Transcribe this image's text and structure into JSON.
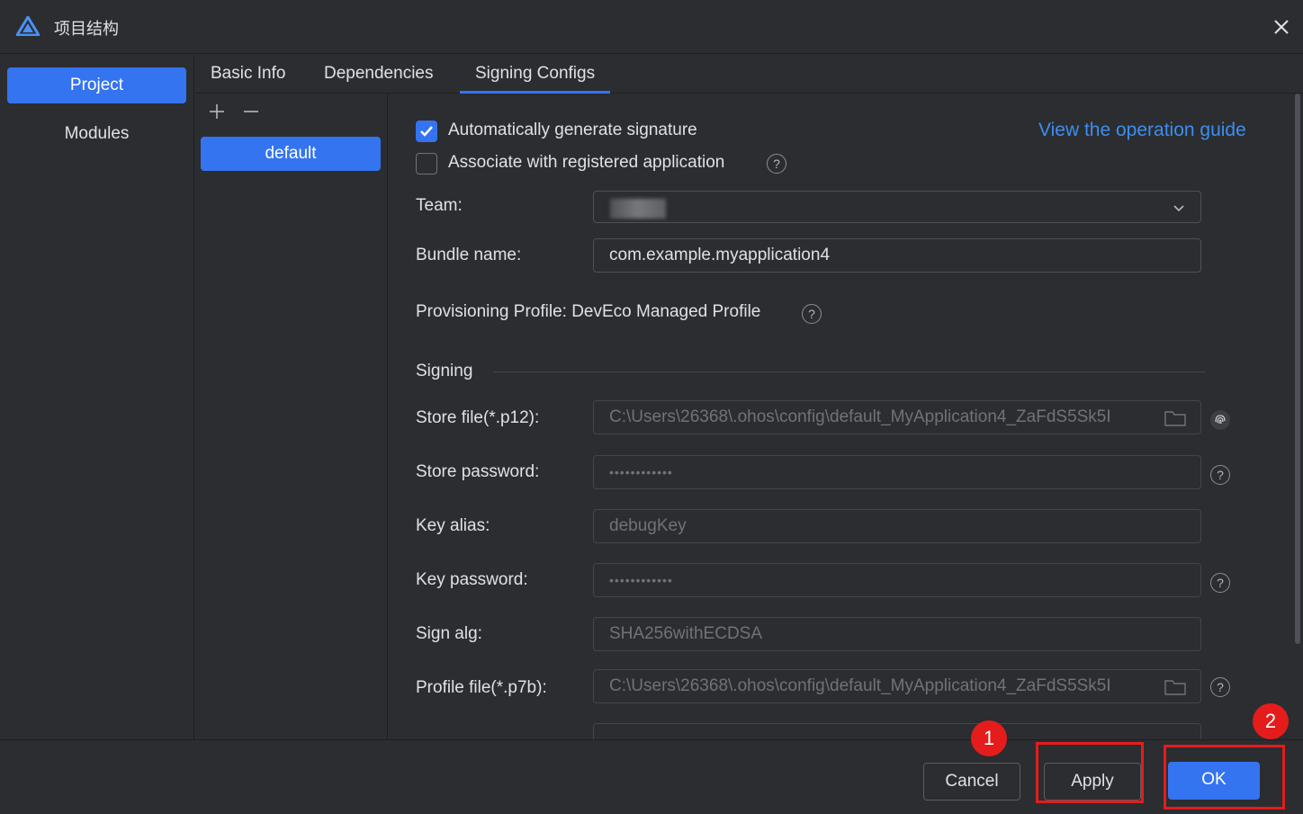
{
  "window": {
    "title": "项目结构"
  },
  "left_nav": {
    "items": [
      {
        "label": "Project",
        "selected": true
      },
      {
        "label": "Modules",
        "selected": false
      }
    ]
  },
  "tabs": [
    {
      "label": "Basic Info",
      "active": false
    },
    {
      "label": "Dependencies",
      "active": false
    },
    {
      "label": "Signing Configs",
      "active": true
    }
  ],
  "configs": {
    "items": [
      {
        "label": "default",
        "selected": true
      }
    ]
  },
  "form": {
    "auto_sign": {
      "label": "Automatically generate signature",
      "checked": true
    },
    "associate": {
      "label": "Associate with registered application",
      "checked": false
    },
    "guide_link": "View the operation guide",
    "team": {
      "label": "Team:"
    },
    "bundle_name": {
      "label": "Bundle name:",
      "value": "com.example.myapplication4"
    },
    "provisioning": "Provisioning Profile: DevEco Managed Profile",
    "signing_section": "Signing",
    "store_file": {
      "label": "Store file(*.p12):",
      "value": "C:\\Users\\26368\\.ohos\\config\\default_MyApplication4_ZaFdS5Sk5I"
    },
    "store_password": {
      "label": "Store password:",
      "value": "••••••••••••"
    },
    "key_alias": {
      "label": "Key alias:",
      "value": "debugKey"
    },
    "key_password": {
      "label": "Key password:",
      "value": "••••••••••••"
    },
    "sign_alg": {
      "label": "Sign alg:",
      "value": "SHA256withECDSA"
    },
    "profile_file": {
      "label": "Profile file(*.p7b):",
      "value": "C:\\Users\\26368\\.ohos\\config\\default_MyApplication4_ZaFdS5Sk5I"
    },
    "help_glyph": "?"
  },
  "footer": {
    "cancel": "Cancel",
    "apply": "Apply",
    "ok": "OK"
  },
  "annotations": {
    "marker_1": "1",
    "marker_2": "2"
  },
  "colors": {
    "accent": "#3574f0",
    "link": "#3d8ef0",
    "highlight": "#e51c1c",
    "background": "#2b2d30"
  }
}
